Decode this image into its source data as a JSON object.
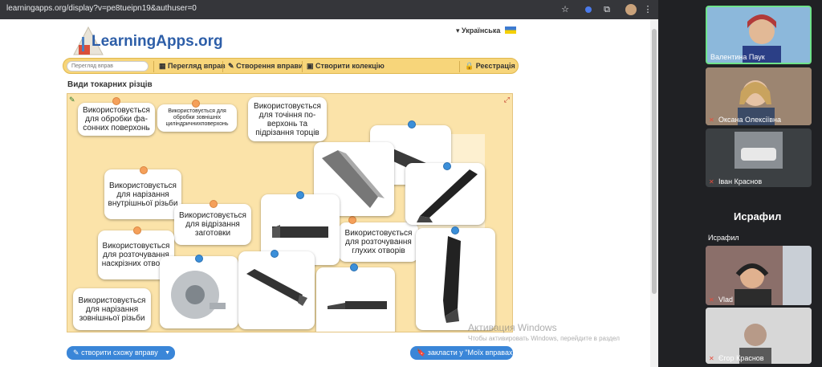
{
  "browser": {
    "url": "learningapps.org/display?v=pe8tueipn19&authuser=0"
  },
  "site": {
    "logo_text": "LearningApps.org",
    "language": "Українська",
    "search_placeholder": "Перегляд вправ",
    "nav": {
      "browse": "Перегляд вправ",
      "create": "Створення вправи",
      "collection": "Створити колекцію",
      "register": "Реєстрація"
    },
    "exercise_title": "Види токарних різців",
    "cards": [
      {
        "text": "Використовується для обробки фа-сонних поверхонь"
      },
      {
        "text": "Використовується для обробки зовнішніх циліндричнихповерхонь"
      },
      {
        "text": "Використовується для точіння по-верхонь та підрізання торців"
      },
      {
        "text": "Використовується для нарізання внутрішньої різьби"
      },
      {
        "text": "Використовується для відрізання заготовки"
      },
      {
        "text": "Використовується для розточування глухих отворів"
      },
      {
        "text": "Використовується для розточування наскрізних отворів"
      },
      {
        "text": "Використовується для нарізання зовнішньої різьби"
      }
    ],
    "buttons": {
      "create_similar": "створити схожу вправу",
      "bookmark": "закласти у \"Моїх вправах\""
    }
  },
  "windows_activation": {
    "title": "Активация Windows",
    "subtitle": "Чтобы активировать Windows, перейдите в раздел"
  },
  "meeting": {
    "participants": [
      {
        "name": "Валентина Паук"
      },
      {
        "name": "Оксана Олексіївна"
      },
      {
        "name": "Іван Краснов"
      },
      {
        "name": "Исрафил"
      },
      {
        "name": "Vlad"
      },
      {
        "name": "Єгор Краснов"
      }
    ],
    "featured_name": "Исрафил"
  }
}
